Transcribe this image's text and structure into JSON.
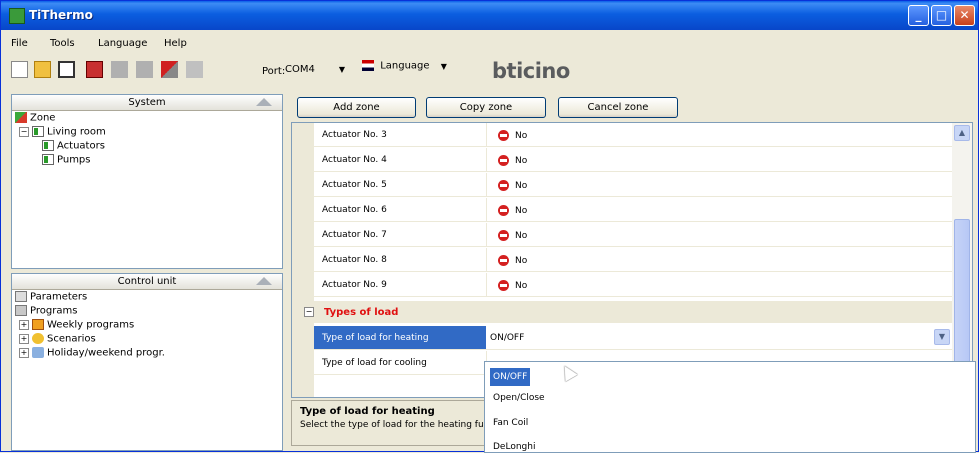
{
  "window": {
    "title": "TiThermo"
  },
  "menu": [
    "File",
    "Tools",
    "Language",
    "Help"
  ],
  "toolbar": {
    "port_label": "Port:",
    "port_value": "COM4",
    "language_label": "Language",
    "logo": "bticino"
  },
  "system_panel": {
    "header": "System",
    "tree": {
      "zone": "Zone",
      "room": "Living room",
      "actuators": "Actuators",
      "pumps": "Pumps"
    }
  },
  "control_panel": {
    "header": "Control unit",
    "items": {
      "parameters": "Parameters",
      "programs": "Programs",
      "weekly": "Weekly programs",
      "scenarios": "Scenarios",
      "holiday": "Holiday/weekend progr."
    }
  },
  "zone_buttons": {
    "add": "Add zone",
    "copy": "Copy zone",
    "cancel": "Cancel zone"
  },
  "grid": {
    "actuators": [
      {
        "name": "Actuator No. 3",
        "value": "No"
      },
      {
        "name": "Actuator No. 4",
        "value": "No"
      },
      {
        "name": "Actuator No. 5",
        "value": "No"
      },
      {
        "name": "Actuator No. 6",
        "value": "No"
      },
      {
        "name": "Actuator No. 7",
        "value": "No"
      },
      {
        "name": "Actuator No. 8",
        "value": "No"
      },
      {
        "name": "Actuator No. 9",
        "value": "No"
      }
    ],
    "category": "Types of load",
    "heating_label": "Type of load for heating",
    "heating_value": "ON/OFF",
    "cooling_label": "Type of load for cooling"
  },
  "dropdown": {
    "options": [
      "ON/OFF",
      "Open/Close",
      "Fan Coil",
      "DeLonghi"
    ]
  },
  "help": {
    "title": "Type of load for heating",
    "description": "Select the type of load for the heating fu"
  },
  "colors": {
    "titlebar": "#0b5ee0",
    "category_text": "#e01010",
    "selection": "#316ac5"
  }
}
